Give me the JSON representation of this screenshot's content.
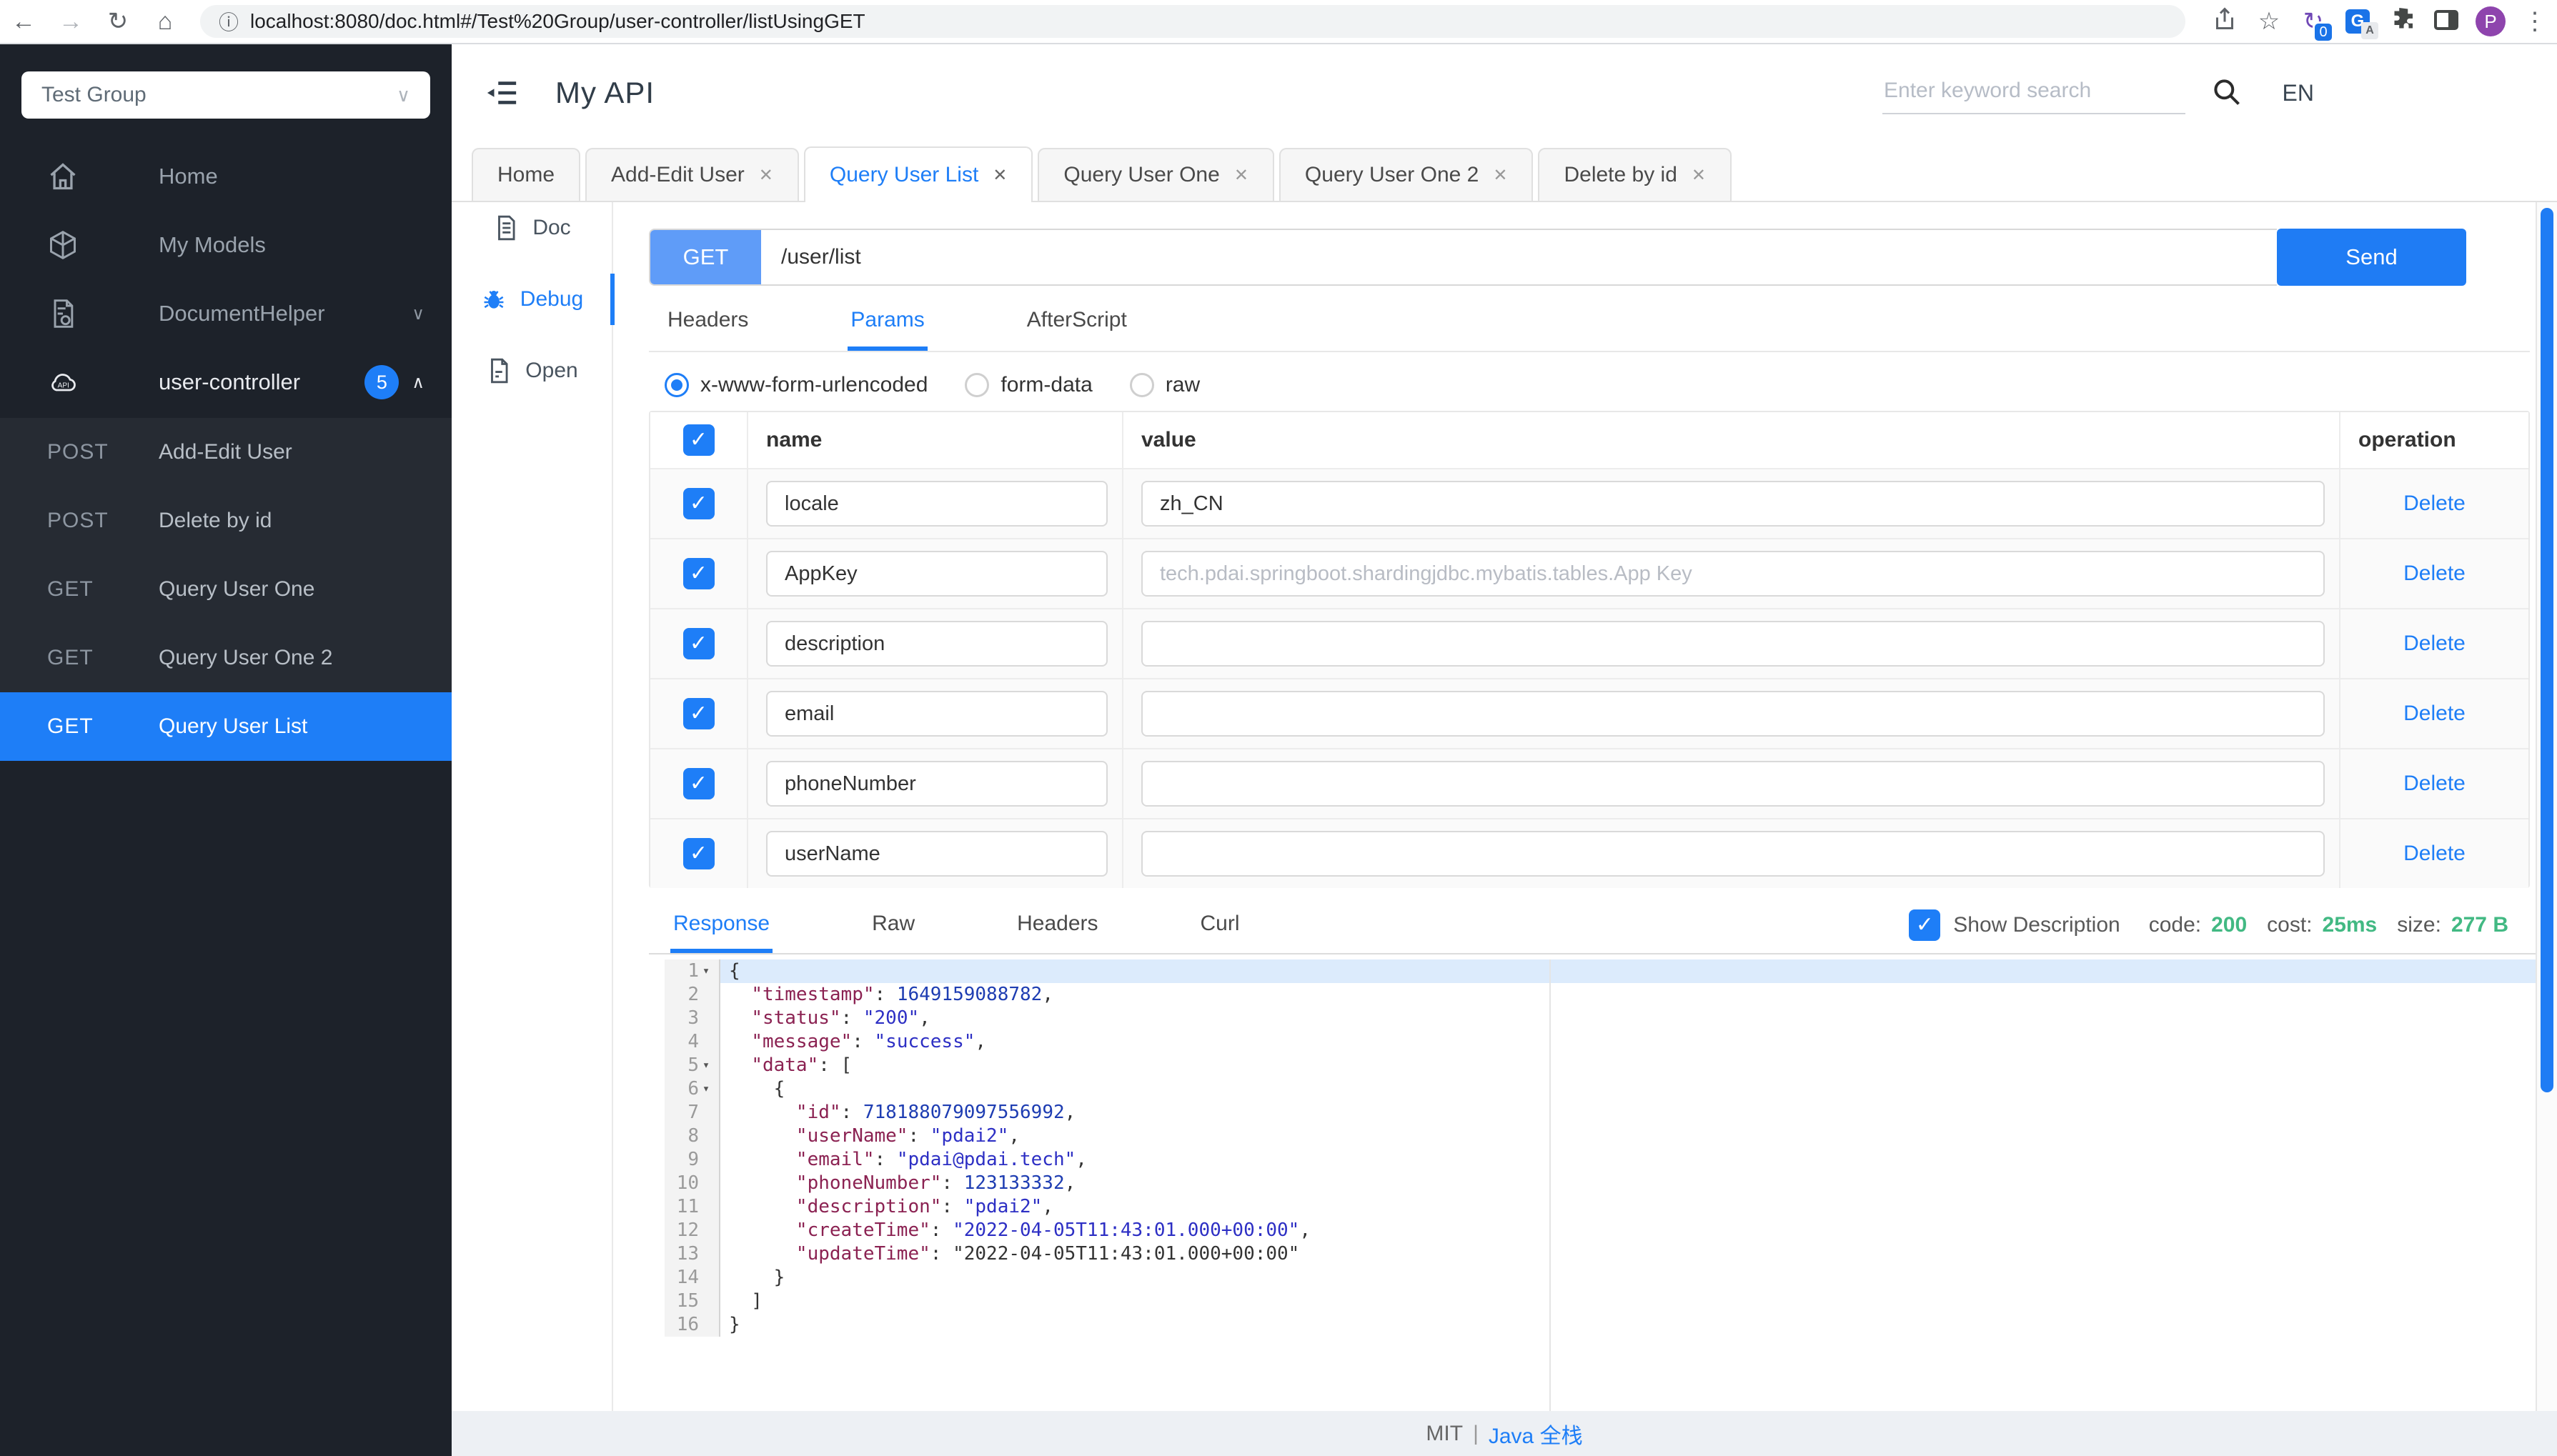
{
  "theme": {
    "accent": "#1e7ef7",
    "green": "#42b983",
    "sidebar_bg": "#1d222a",
    "sidebar_sub_bg": "#262b33",
    "selected_blue": "#1e7ef7",
    "key_color": "#8b2252",
    "string_color": "#2d2fc4",
    "number_color": "#1e3db2"
  },
  "icons": {
    "check": "✓",
    "close": "✕",
    "chevron_down": "∨",
    "chevron_up": "∧",
    "back": "←",
    "forward": "→",
    "reload": "↻",
    "home": "⌂",
    "info": "ⓘ",
    "star": "☆",
    "kebab": "⋮",
    "sync": "↻"
  },
  "browser": {
    "url": "localhost:8080/doc.html#/Test%20Group/user-controller/listUsingGET",
    "sync_badge": "0",
    "translate_letter": "G",
    "translate_sub": "A",
    "profile_initial": "P"
  },
  "sidebar": {
    "group_select": "Test Group",
    "nav": [
      {
        "label": "Home"
      },
      {
        "label": "My Models"
      },
      {
        "label": "DocumentHelper"
      },
      {
        "label": "user-controller",
        "badge": "5"
      }
    ],
    "endpoints": [
      {
        "method": "POST",
        "label": "Add-Edit User"
      },
      {
        "method": "POST",
        "label": "Delete by id"
      },
      {
        "method": "GET",
        "label": "Query User One"
      },
      {
        "method": "GET",
        "label": "Query User One 2"
      },
      {
        "method": "GET",
        "label": "Query User List"
      }
    ]
  },
  "header": {
    "title": "My API",
    "search_placeholder": "Enter keyword search",
    "lang": "EN"
  },
  "doc_tabs": [
    {
      "label": "Home"
    },
    {
      "label": "Add-Edit User"
    },
    {
      "label": "Query User List"
    },
    {
      "label": "Query User One"
    },
    {
      "label": "Query User One 2"
    },
    {
      "label": "Delete by id"
    }
  ],
  "side_nav": [
    {
      "label": "Doc"
    },
    {
      "label": "Debug"
    },
    {
      "label": "Open"
    }
  ],
  "debug": {
    "method": "GET",
    "url": "/user/list",
    "send": "Send",
    "req_tabs": [
      {
        "label": "Headers"
      },
      {
        "label": "Params"
      },
      {
        "label": "AfterScript"
      }
    ],
    "body_types": [
      {
        "label": "x-www-form-urlencoded"
      },
      {
        "label": "form-data"
      },
      {
        "label": "raw"
      }
    ],
    "table": {
      "col_name": "name",
      "col_value": "value",
      "col_op": "operation",
      "delete_label": "Delete",
      "rows": [
        {
          "name": "locale",
          "value": "zh_CN",
          "placeholder": ""
        },
        {
          "name": "AppKey",
          "value": "",
          "placeholder": "tech.pdai.springboot.shardingjdbc.mybatis.tables.App Key"
        },
        {
          "name": "description",
          "value": "",
          "placeholder": ""
        },
        {
          "name": "email",
          "value": "",
          "placeholder": ""
        },
        {
          "name": "phoneNumber",
          "value": "",
          "placeholder": ""
        },
        {
          "name": "userName",
          "value": "",
          "placeholder": ""
        }
      ]
    }
  },
  "response": {
    "tabs": [
      {
        "label": "Response"
      },
      {
        "label": "Raw"
      },
      {
        "label": "Headers"
      },
      {
        "label": "Curl"
      }
    ],
    "show_description": "Show Description",
    "stats": [
      {
        "label": "code:",
        "value": "200"
      },
      {
        "label": "cost:",
        "value": "25ms"
      },
      {
        "label": "size:",
        "value": "277 B"
      }
    ],
    "lines": [
      {
        "n": "1",
        "f": "▾",
        "pre": "{",
        "key": "",
        "mid": "",
        "val": "",
        "vc": "code-val",
        "tail": ""
      },
      {
        "n": "2",
        "f": "",
        "pre": "  ",
        "key": "\"timestamp\"",
        "mid": ": ",
        "val": "1649159088782",
        "vc": "code-val num",
        "tail": ","
      },
      {
        "n": "3",
        "f": "",
        "pre": "  ",
        "key": "\"status\"",
        "mid": ": ",
        "val": "\"200\"",
        "vc": "code-val str",
        "tail": ","
      },
      {
        "n": "4",
        "f": "",
        "pre": "  ",
        "key": "\"message\"",
        "mid": ": ",
        "val": "\"success\"",
        "vc": "code-val str",
        "tail": ","
      },
      {
        "n": "5",
        "f": "▾",
        "pre": "  ",
        "key": "\"data\"",
        "mid": ": [",
        "val": "",
        "vc": "code-val",
        "tail": ""
      },
      {
        "n": "6",
        "f": "▾",
        "pre": "    {",
        "key": "",
        "mid": "",
        "val": "",
        "vc": "code-val",
        "tail": ""
      },
      {
        "n": "7",
        "f": "",
        "pre": "      ",
        "key": "\"id\"",
        "mid": ": ",
        "val": "718188079097556992",
        "vc": "code-val num",
        "tail": ","
      },
      {
        "n": "8",
        "f": "",
        "pre": "      ",
        "key": "\"userName\"",
        "mid": ": ",
        "val": "\"pdai2\"",
        "vc": "code-val str",
        "tail": ","
      },
      {
        "n": "9",
        "f": "",
        "pre": "      ",
        "key": "\"email\"",
        "mid": ": ",
        "val": "\"pdai@pdai.tech\"",
        "vc": "code-val str",
        "tail": ","
      },
      {
        "n": "10",
        "f": "",
        "pre": "      ",
        "key": "\"phoneNumber\"",
        "mid": ": ",
        "val": "123133332",
        "vc": "code-val num",
        "tail": ","
      },
      {
        "n": "11",
        "f": "",
        "pre": "      ",
        "key": "\"description\"",
        "mid": ": ",
        "val": "\"pdai2\"",
        "vc": "code-val str",
        "tail": ","
      },
      {
        "n": "12",
        "f": "",
        "pre": "      ",
        "key": "\"createTime\"",
        "mid": ": ",
        "val": "\"2022-04-05T11:43:01.000+00:00\"",
        "vc": "code-val str",
        "tail": ","
      },
      {
        "n": "13",
        "f": "",
        "pre": "      ",
        "key": "\"updateTime\"",
        "mid": ": ",
        "val": "\"2022-04-05T11:43:01.000+00:00\"",
        "vc": "code-val",
        "tail": ""
      },
      {
        "n": "14",
        "f": "",
        "pre": "    }",
        "key": "",
        "mid": "",
        "val": "",
        "vc": "code-val",
        "tail": ""
      },
      {
        "n": "15",
        "f": "",
        "pre": "  ]",
        "key": "",
        "mid": "",
        "val": "",
        "vc": "code-val",
        "tail": ""
      },
      {
        "n": "16",
        "f": "",
        "pre": "}",
        "key": "",
        "mid": "",
        "val": "",
        "vc": "code-val",
        "tail": ""
      }
    ]
  },
  "footer": {
    "license": "MIT",
    "sep": "|",
    "link": "Java 全栈"
  }
}
